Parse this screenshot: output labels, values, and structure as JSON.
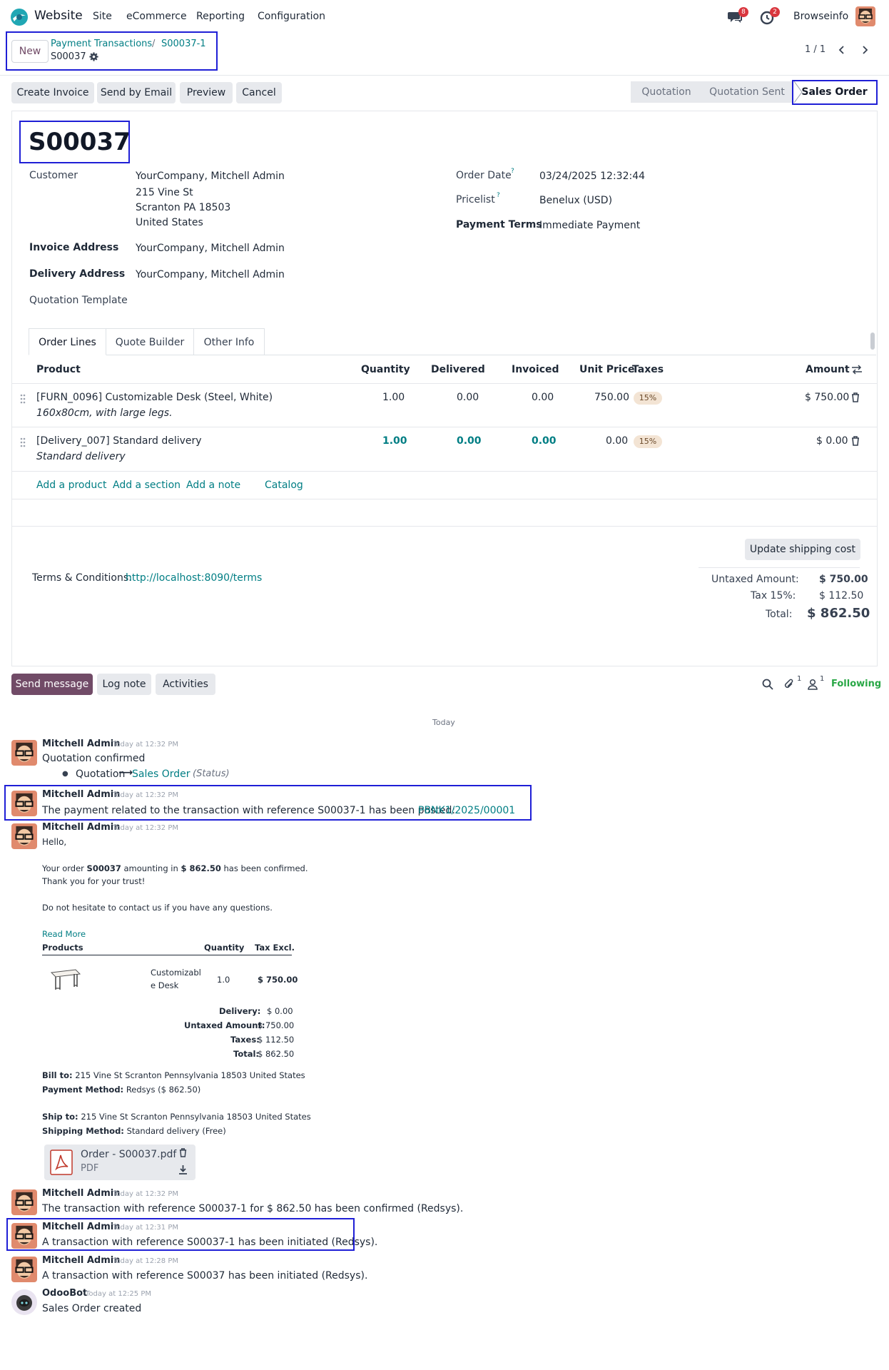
{
  "nav": {
    "app_name": "Website",
    "menu": [
      "Site",
      "eCommerce",
      "Reporting",
      "Configuration"
    ],
    "messages_badge": "8",
    "activities_badge": "2",
    "company": "Browseinfo"
  },
  "control": {
    "new_label": "New",
    "breadcrumb_parent": "Payment Transactions",
    "breadcrumb_sep": "/",
    "breadcrumb_current": "S00037-1",
    "record_name": "S00037",
    "pager": "1 / 1"
  },
  "actions": {
    "create_invoice": "Create Invoice",
    "send_email": "Send by Email",
    "preview": "Preview",
    "cancel": "Cancel"
  },
  "statusbar": [
    "Quotation",
    "Quotation Sent",
    "Sales Order"
  ],
  "form": {
    "title": "S00037",
    "customer_label": "Customer",
    "customer_name": "YourCompany, Mitchell Admin",
    "address_1": "215 Vine St",
    "address_2": "Scranton PA 18503",
    "address_3": "United States",
    "invoice_label": "Invoice Address",
    "invoice_value": "YourCompany, Mitchell Admin",
    "delivery_label": "Delivery Address",
    "delivery_value": "YourCompany, Mitchell Admin",
    "template_label": "Quotation Template",
    "order_date_label": "Order Date",
    "order_date_value": "03/24/2025 12:32:44",
    "pricelist_label": "Pricelist",
    "pricelist_value": "Benelux (USD)",
    "terms_label": "Payment Terms",
    "terms_value": "Immediate Payment",
    "help_mark": "?"
  },
  "tabs": [
    "Order Lines",
    "Quote Builder",
    "Other Info"
  ],
  "lines": {
    "headers": {
      "product": "Product",
      "quantity": "Quantity",
      "delivered": "Delivered",
      "invoiced": "Invoiced",
      "unit_price": "Unit Price",
      "taxes": "Taxes",
      "amount": "Amount"
    },
    "rows": [
      {
        "product": "[FURN_0096] Customizable Desk (Steel, White)",
        "description": "160x80cm, with large legs.",
        "quantity": "1.00",
        "delivered": "0.00",
        "invoiced": "0.00",
        "unit_price": "750.00",
        "tax": "15%",
        "amount": "$ 750.00"
      },
      {
        "product": "[Delivery_007] Standard delivery",
        "description": "Standard delivery",
        "quantity": "1.00",
        "delivered": "0.00",
        "invoiced": "0.00",
        "unit_price": "0.00",
        "tax": "15%",
        "amount": "$ 0.00"
      }
    ],
    "add_product": "Add a product",
    "add_section": "Add a section",
    "add_note": "Add a note",
    "catalog": "Catalog"
  },
  "totals": {
    "update_shipping": "Update shipping cost",
    "terms_label": "Terms & Conditions:",
    "terms_link": "http://localhost:8090/terms",
    "untaxed_label": "Untaxed Amount:",
    "untaxed_value": "$ 750.00",
    "tax_label": "Tax 15%:",
    "tax_value": "$ 112.50",
    "total_label": "Total:",
    "total_value": "$ 862.50"
  },
  "chatter": {
    "send_message": "Send message",
    "log_note": "Log note",
    "activities": "Activities",
    "attachments_count": "1",
    "followers_count": "1",
    "following": "Following",
    "day_separator": "Today",
    "messages": [
      {
        "author": "Mitchell Admin",
        "time": "Today at 12:32 PM",
        "body": "Quotation confirmed"
      },
      {
        "author": "Mitchell Admin",
        "time": "Today at 12:32 PM",
        "body": "The payment related to the transaction with reference S00037-1 has been posted:",
        "link": "PBNK1/2025/00001"
      },
      {
        "author": "Mitchell Admin",
        "time": "Today at 12:32 PM",
        "body": "Hello,"
      },
      {
        "author": "Mitchell Admin",
        "time": "Today at 12:32 PM",
        "body": "The transaction with reference S00037-1 for $ 862.50 has been confirmed (Redsys)."
      },
      {
        "author": "Mitchell Admin",
        "time": "Today at 12:31 PM",
        "body": "A transaction with reference S00037-1 has been initiated (Redsys)."
      },
      {
        "author": "Mitchell Admin",
        "time": "Today at 12:28 PM",
        "body": "A transaction with reference S00037 has been initiated (Redsys)."
      },
      {
        "author": "OdooBot",
        "time": "Today at 12:25 PM",
        "body": "Sales Order created"
      }
    ],
    "tracking_old": "Quotation",
    "tracking_arrow": "⟶",
    "tracking_new": "Sales Order",
    "tracking_field": "(Status)"
  },
  "email": {
    "line1_a": "Your order",
    "line1_order": "S00037",
    "line1_b": "amounting in",
    "line1_amount": "$ 862.50",
    "line1_c": "has been confirmed.",
    "line2": "Thank you for your trust!",
    "line3": "Do not hesitate to contact us if you have any questions.",
    "read_more": "Read More",
    "col_products": "Products",
    "col_quantity": "Quantity",
    "col_tax": "Tax Excl.",
    "product_name_1": "Customizabl",
    "product_name_2": "e Desk",
    "product_qty": "1.0",
    "product_price": "$ 750.00",
    "delivery_label": "Delivery:",
    "delivery_value": "$ 0.00",
    "untaxed_label": "Untaxed Amount:",
    "untaxed_value": "$ 750.00",
    "taxes_label": "Taxes:",
    "taxes_value": "$ 112.50",
    "total_label": "Total:",
    "total_value": "$ 862.50",
    "bill_label": "Bill to:",
    "bill_value": "215 Vine St Scranton Pennsylvania 18503 United States",
    "payment_label": "Payment Method:",
    "payment_value": "Redsys ($ 862.50)",
    "ship_label": "Ship to:",
    "ship_value": "215 Vine St Scranton Pennsylvania 18503 United States",
    "shipping_label": "Shipping Method:",
    "shipping_value": "Standard delivery (Free)",
    "attachment_name": "Order - S00037.pdf",
    "attachment_type": "PDF"
  },
  "colors": {
    "brand": "#714b67",
    "link": "#017e84",
    "highlight": "#1f1fd6"
  }
}
